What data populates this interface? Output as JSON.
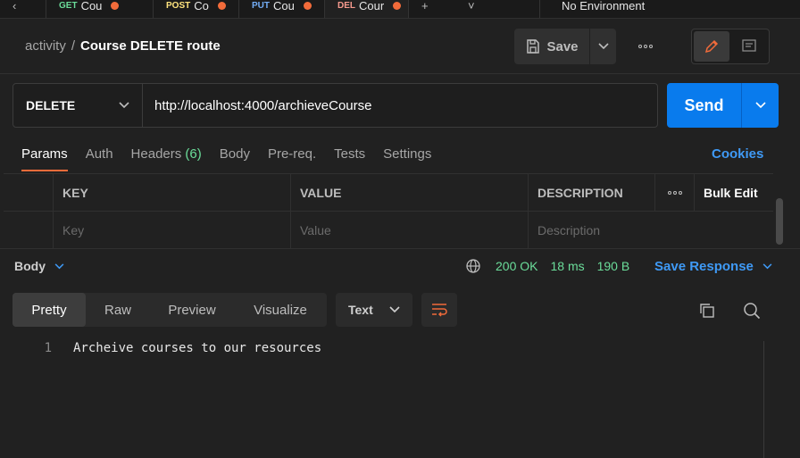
{
  "tabs": [
    {
      "method": "GET",
      "name": "Cou"
    },
    {
      "method": "POST",
      "name": "Co"
    },
    {
      "method": "PUT",
      "name": "Cou"
    },
    {
      "method": "DEL",
      "name": "Cour"
    }
  ],
  "environment": "No Environment",
  "breadcrumb": {
    "parent": "activity",
    "separator": "/",
    "title": "Course DELETE route"
  },
  "toolbar": {
    "save_label": "Save"
  },
  "request": {
    "method": "DELETE",
    "url": "http://localhost:4000/archieveCourse",
    "send_label": "Send"
  },
  "request_tabs": [
    {
      "label": "Params",
      "count": ""
    },
    {
      "label": "Auth",
      "count": ""
    },
    {
      "label": "Headers",
      "count": "(6)"
    },
    {
      "label": "Body",
      "count": ""
    },
    {
      "label": "Pre-req.",
      "count": ""
    },
    {
      "label": "Tests",
      "count": ""
    },
    {
      "label": "Settings",
      "count": ""
    }
  ],
  "cookies_label": "Cookies",
  "params_table": {
    "headers": {
      "key": "KEY",
      "value": "VALUE",
      "description": "DESCRIPTION",
      "bulk_edit": "Bulk Edit"
    },
    "placeholders": {
      "key": "Key",
      "value": "Value",
      "description": "Description"
    }
  },
  "response": {
    "section_label": "Body",
    "status": "200 OK",
    "time": "18 ms",
    "size": "190 B",
    "save_label": "Save Response",
    "views": [
      "Pretty",
      "Raw",
      "Preview",
      "Visualize"
    ],
    "active_view": "Pretty",
    "format": "Text",
    "lines": [
      {
        "number": "1",
        "text": "Archeive courses to our resources"
      }
    ]
  },
  "colors": {
    "accent": "#f26b3a",
    "send": "#097bed",
    "link": "#3f9af6",
    "success": "#6bdd9a"
  }
}
